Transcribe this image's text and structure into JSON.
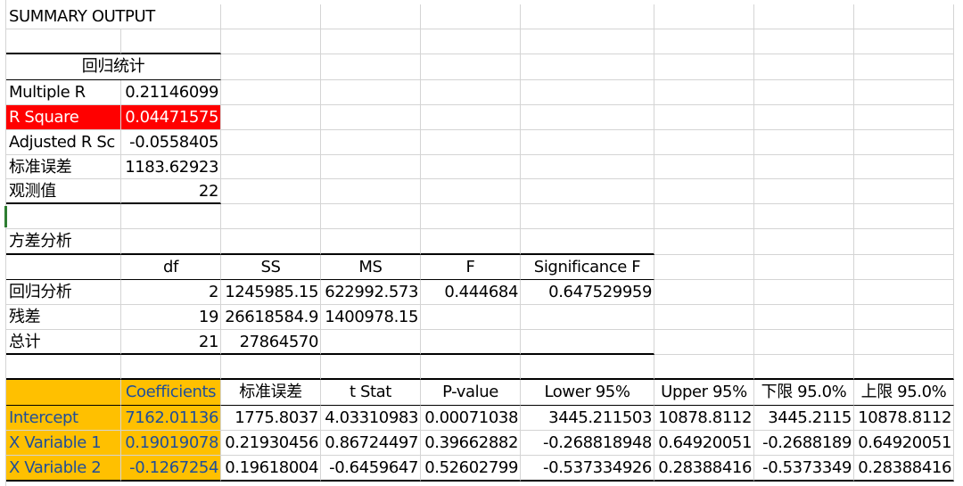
{
  "sheet": {
    "title": "SUMMARY OUTPUT",
    "regression_stats": {
      "header": "回归统计",
      "rows": [
        {
          "label": "Multiple R",
          "value": "0.21146099"
        },
        {
          "label": "R Square",
          "value": "0.04471575"
        },
        {
          "label": "Adjusted R Sc",
          "value": "-0.0558405"
        },
        {
          "label": "标准误差",
          "value": "1183.62923"
        },
        {
          "label": "观测值",
          "value": "22"
        }
      ]
    },
    "anova": {
      "header": "方差分析",
      "columns": [
        "df",
        "SS",
        "MS",
        "F",
        "Significance F"
      ],
      "rows": [
        {
          "label": "回归分析",
          "df": "2",
          "ss": "1245985.15",
          "ms": "622992.573",
          "f": "0.444684",
          "sig": "0.647529959"
        },
        {
          "label": "残差",
          "df": "19",
          "ss": "26618584.9",
          "ms": "1400978.15",
          "f": "",
          "sig": ""
        },
        {
          "label": "总计",
          "df": "21",
          "ss": "27864570",
          "ms": "",
          "f": "",
          "sig": ""
        }
      ]
    },
    "coefficients": {
      "columns": [
        "Coefficients",
        "标准误差",
        "t Stat",
        "P-value",
        "Lower 95%",
        "Upper 95%",
        "下限 95.0%",
        "上限 95.0%"
      ],
      "rows": [
        {
          "label": "Intercept",
          "values": [
            "7162.01136",
            "1775.8037",
            "4.03310983",
            "0.00071038",
            "3445.211503",
            "10878.8112",
            "3445.2115",
            "10878.8112"
          ]
        },
        {
          "label": "X Variable 1",
          "values": [
            "0.19019078",
            "0.21930456",
            "0.86724497",
            "0.39662882",
            "-0.268818948",
            "0.64920051",
            "-0.2688189",
            "0.64920051"
          ]
        },
        {
          "label": "X Variable 2",
          "values": [
            "-0.1267254",
            "0.19618004",
            "-0.6459647",
            "0.52602799",
            "-0.537334926",
            "0.28388416",
            "-0.5373349",
            "0.28388416"
          ]
        }
      ]
    },
    "colors": {
      "highlight_red": "#ff0000",
      "highlight_orange": "#ffc000",
      "label_blue": "#1f4e9a",
      "gridline": "#d4d4d4"
    }
  }
}
